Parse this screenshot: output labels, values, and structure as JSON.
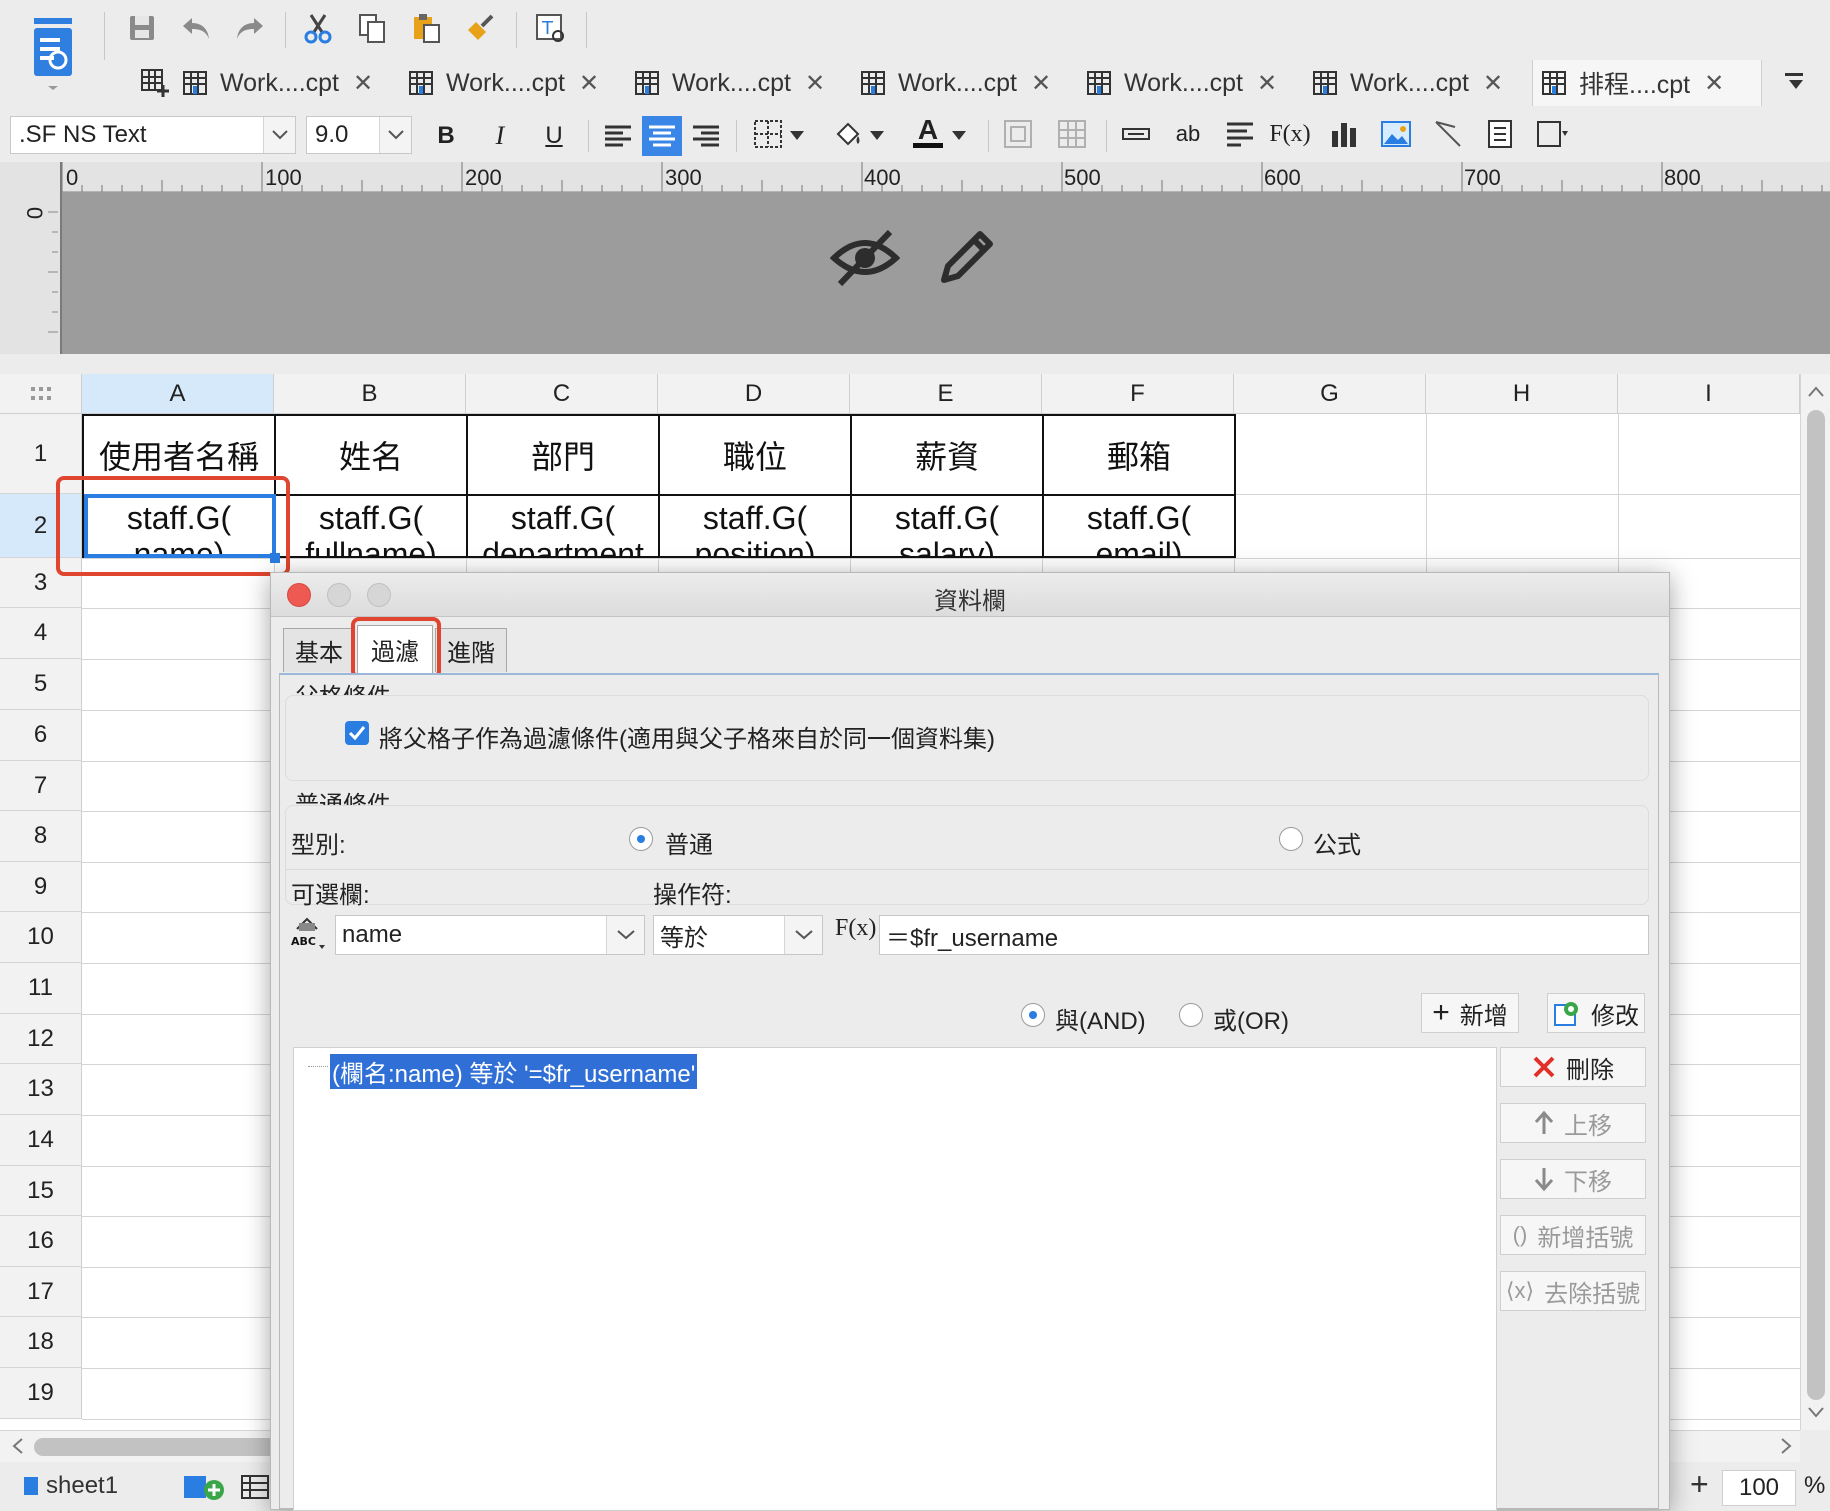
{
  "toolbar": {
    "font_name": ".SF NS Text",
    "font_size": "9.0",
    "bold": "B",
    "italic": "I",
    "underline": "U",
    "text_widget": "ab",
    "font_color": "A"
  },
  "tabs": [
    {
      "label": "Work....cpt"
    },
    {
      "label": "Work....cpt"
    },
    {
      "label": "Work....cpt"
    },
    {
      "label": "Work....cpt"
    },
    {
      "label": "Work....cpt"
    },
    {
      "label": "Work....cpt"
    },
    {
      "label": "排程....cpt"
    }
  ],
  "ruler": {
    "marks": [
      "0",
      "100",
      "200",
      "300",
      "400",
      "500",
      "600",
      "700",
      "800"
    ],
    "vertical_mark": "0"
  },
  "sheet": {
    "columns": [
      "A",
      "B",
      "C",
      "D",
      "E",
      "F",
      "G",
      "H",
      "I"
    ],
    "rows": [
      "1",
      "2",
      "3",
      "4",
      "5",
      "6",
      "7",
      "8",
      "9",
      "10",
      "11",
      "12",
      "13",
      "14",
      "15",
      "16",
      "17",
      "18",
      "19"
    ],
    "headers": [
      "使用者名稱",
      "姓名",
      "部門",
      "職位",
      "薪資",
      "郵箱"
    ],
    "row2_line1": [
      "staff.G(",
      "staff.G(",
      "staff.G(",
      "staff.G(",
      "staff.G(",
      "staff.G("
    ],
    "row2_line2": [
      "name)",
      "fullname)",
      "department",
      "position)",
      "salary)",
      "email)"
    ]
  },
  "bottom": {
    "sheet_tab": "sheet1",
    "zoom": "100",
    "zoom_unit": "%",
    "zoom_plus": "+"
  },
  "dialog": {
    "title": "資料欄",
    "tabs": [
      "基本",
      "過濾",
      "進階"
    ],
    "parent_group_title": "父格條件",
    "parent_checkbox_label": "將父格子作為過濾條件(適用與父子格來自於同一個資料集)",
    "parent_checked": true,
    "common_group_title": "普通條件",
    "type_label": "型別:",
    "type_options": [
      "普通",
      "公式"
    ],
    "type_selected": "普通",
    "column_label": "可選欄:",
    "operator_label": "操作符:",
    "column_value": "name",
    "operator_value": "等於",
    "formula_icon": "F(x)",
    "value_text": "＝$fr_username",
    "logic_options": [
      "與(AND)",
      "或(OR)"
    ],
    "logic_selected": "與(AND)",
    "add_button": "新增",
    "edit_button": "修改",
    "condition_item": "(欄名:name) 等於 '=$fr_username'",
    "delete_button": "刪除",
    "up_button": "上移",
    "down_button": "下移",
    "add_bracket_button": "新增括號",
    "remove_bracket_button": "去除括號"
  },
  "colors": {
    "highlight_red": "#e0452f",
    "selection_blue": "#2a7de1",
    "list_selection": "#2f6fd6"
  }
}
